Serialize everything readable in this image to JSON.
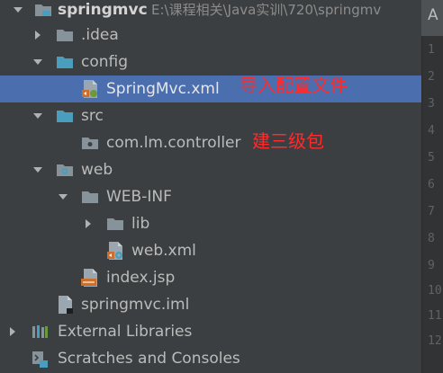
{
  "project_tree": {
    "root": {
      "name": "springmvc",
      "path": "E:\\课程相关\\Java实训\\720\\springmv"
    },
    "items": [
      {
        "name": ".idea"
      },
      {
        "name": "config"
      },
      {
        "name": "SpringMvc.xml"
      },
      {
        "name": "src"
      },
      {
        "name": "com.lm.controller"
      },
      {
        "name": "web"
      },
      {
        "name": "WEB-INF"
      },
      {
        "name": "lib"
      },
      {
        "name": "web.xml"
      },
      {
        "name": "index.jsp"
      },
      {
        "name": "springmvc.iml"
      },
      {
        "name": "External Libraries"
      },
      {
        "name": "Scratches and Consoles"
      }
    ]
  },
  "annotations": {
    "import_config": "导入配置文件",
    "create_packages": "建三级包"
  },
  "editor": {
    "tab_label": "A",
    "line_numbers": [
      "1",
      "2",
      "3",
      "4",
      "5",
      "6",
      "7",
      "8",
      "9",
      "10",
      "11",
      "12"
    ]
  },
  "icons": {
    "expanded": "chevron-down-icon",
    "collapsed": "chevron-right-icon",
    "module": "module-folder-icon",
    "folder": "folder-icon",
    "source_folder": "source-folder-icon",
    "package": "package-icon",
    "web_folder": "web-folder-icon",
    "spring_xml": "spring-xml-file-icon",
    "web_xml": "web-xml-file-icon",
    "jsp": "jsp-file-icon",
    "iml": "iml-file-icon",
    "libraries": "libraries-icon",
    "scratches": "scratches-icon"
  },
  "colors": {
    "background": "#3c3f41",
    "selection": "#4b6eaf",
    "text": "#bbbbbb",
    "folder": "#87939a",
    "source_folder": "#4a9ebd",
    "annotation": "#ff2a2a"
  }
}
